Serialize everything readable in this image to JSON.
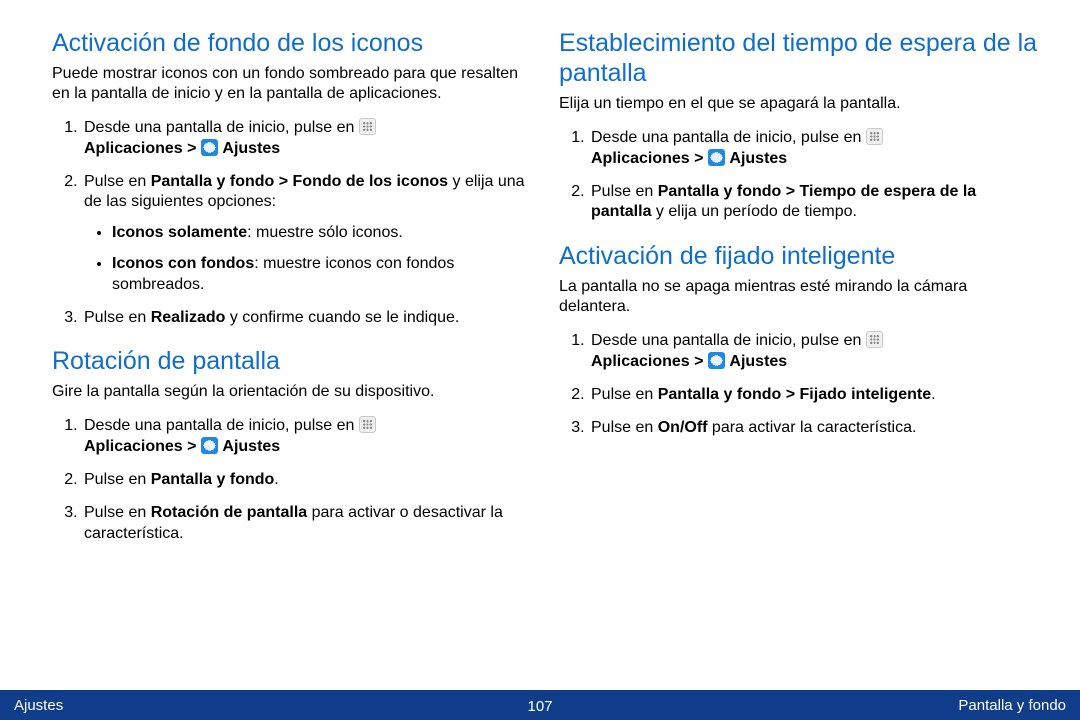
{
  "left": {
    "sec1": {
      "heading": "Activación de fondo de los iconos",
      "intro": "Puede mostrar iconos con un fondo sombreado para que resalten en la pantalla de inicio y en la pantalla de aplicaciones.",
      "step1_pre": "Desde una pantalla de inicio, pulse en ",
      "step1_apps": "Aplicaciones > ",
      "step1_settings": " Ajustes",
      "step2_a": "Pulse en ",
      "step2_b": "Pantalla y fondo > Fondo de los iconos",
      "step2_c": " y elija una de las siguientes opciones:",
      "bullet1_a": "Iconos solamente",
      "bullet1_b": ": muestre sólo iconos.",
      "bullet2_a": "Iconos con fondos",
      "bullet2_b": ": muestre iconos con fondos sombreados.",
      "step3_a": "Pulse en ",
      "step3_b": "Realizado",
      "step3_c": " y confirme cuando se le indique."
    },
    "sec2": {
      "heading": "Rotación de pantalla",
      "intro": "Gire la pantalla según la orientación de su dispositivo.",
      "step1_pre": "Desde una pantalla de inicio, pulse en ",
      "step1_apps": "Aplicaciones > ",
      "step1_settings": " Ajustes",
      "step2_a": "Pulse en ",
      "step2_b": "Pantalla y fondo",
      "step2_c": ".",
      "step3_a": "Pulse en ",
      "step3_b": "Rotación de pantalla",
      "step3_c": " para activar o desactivar la característica."
    }
  },
  "right": {
    "sec1": {
      "heading": "Establecimiento del tiempo de espera de la pantalla",
      "intro": "Elija un tiempo en el que se apagará la pantalla.",
      "step1_pre": "Desde una pantalla de inicio, pulse en ",
      "step1_apps": "Aplicaciones > ",
      "step1_settings": " Ajustes",
      "step2_a": "Pulse en ",
      "step2_b": "Pantalla y fondo > Tiempo de espera de la pantalla",
      "step2_c": " y elija un período de tiempo."
    },
    "sec2": {
      "heading": "Activación de fijado inteligente",
      "intro": "La pantalla no se apaga mientras esté mirando la cámara delantera.",
      "step1_pre": "Desde una pantalla de inicio, pulse en ",
      "step1_apps": "Aplicaciones > ",
      "step1_settings": " Ajustes",
      "step2_a": "Pulse en ",
      "step2_b": "Pantalla y fondo > Fijado inteligente",
      "step2_c": ".",
      "step3_a": "Pulse en ",
      "step3_b": "On/Off",
      "step3_c": " para activar la característica."
    }
  },
  "footer": {
    "left": "Ajustes",
    "page": "107",
    "right": "Pantalla y fondo"
  }
}
